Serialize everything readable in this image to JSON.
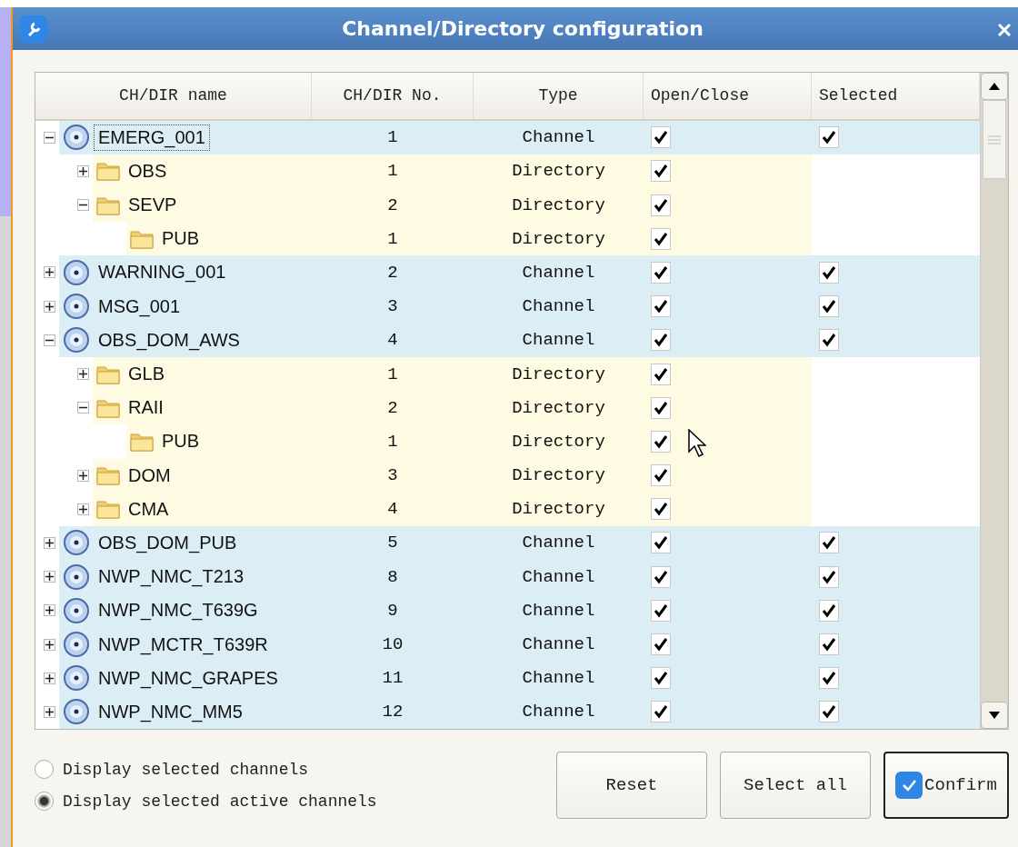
{
  "window": {
    "title": "Channel/Directory configuration"
  },
  "table": {
    "columns": [
      "CH/DIR name",
      "CH/DIR No.",
      "Type",
      "Open/Close",
      "Selected"
    ],
    "rows": [
      {
        "kind": "channel",
        "name": "EMERG_001",
        "number": "1",
        "type": "Channel",
        "open": true,
        "selected": true,
        "expanded": true,
        "focused": true,
        "children": [
          {
            "kind": "directory",
            "name": "OBS",
            "number": "1",
            "type": "Directory",
            "open": true,
            "expanded": false,
            "focused": false
          },
          {
            "kind": "directory",
            "name": "SEVP",
            "number": "2",
            "type": "Directory",
            "open": true,
            "expanded": true,
            "focused": false,
            "children": [
              {
                "kind": "directory",
                "name": "PUB",
                "number": "1",
                "type": "Directory",
                "open": true,
                "focused": false
              }
            ]
          }
        ]
      },
      {
        "kind": "channel",
        "name": "WARNING_001",
        "number": "2",
        "type": "Channel",
        "open": true,
        "selected": true,
        "expanded": false,
        "focused": false
      },
      {
        "kind": "channel",
        "name": "MSG_001",
        "number": "3",
        "type": "Channel",
        "open": true,
        "selected": true,
        "expanded": false,
        "focused": false
      },
      {
        "kind": "channel",
        "name": "OBS_DOM_AWS",
        "number": "4",
        "type": "Channel",
        "open": true,
        "selected": true,
        "expanded": true,
        "focused": false,
        "children": [
          {
            "kind": "directory",
            "name": "GLB",
            "number": "1",
            "type": "Directory",
            "open": true,
            "expanded": false,
            "focused": false
          },
          {
            "kind": "directory",
            "name": "RAII",
            "number": "2",
            "type": "Directory",
            "open": true,
            "expanded": true,
            "focused": false,
            "children": [
              {
                "kind": "directory",
                "name": "PUB",
                "number": "1",
                "type": "Directory",
                "open": true,
                "focused": false
              }
            ]
          },
          {
            "kind": "directory",
            "name": "DOM",
            "number": "3",
            "type": "Directory",
            "open": true,
            "expanded": false,
            "focused": false
          },
          {
            "kind": "directory",
            "name": "CMA",
            "number": "4",
            "type": "Directory",
            "open": true,
            "expanded": false,
            "focused": false
          }
        ]
      },
      {
        "kind": "channel",
        "name": "OBS_DOM_PUB",
        "number": "5",
        "type": "Channel",
        "open": true,
        "selected": true,
        "expanded": false,
        "focused": false
      },
      {
        "kind": "channel",
        "name": "NWP_NMC_T213",
        "number": "8",
        "type": "Channel",
        "open": true,
        "selected": true,
        "expanded": false,
        "focused": false
      },
      {
        "kind": "channel",
        "name": "NWP_NMC_T639G",
        "number": "9",
        "type": "Channel",
        "open": true,
        "selected": true,
        "expanded": false,
        "focused": false
      },
      {
        "kind": "channel",
        "name": "NWP_MCTR_T639R",
        "number": "10",
        "type": "Channel",
        "open": true,
        "selected": true,
        "expanded": false,
        "focused": false
      },
      {
        "kind": "channel",
        "name": "NWP_NMC_GRAPES",
        "number": "11",
        "type": "Channel",
        "open": true,
        "selected": true,
        "expanded": false,
        "focused": false
      },
      {
        "kind": "channel",
        "name": "NWP_NMC_MM5",
        "number": "12",
        "type": "Channel",
        "open": true,
        "selected": true,
        "expanded": false,
        "focused": false
      }
    ]
  },
  "display_options": [
    {
      "label": "Display selected channels",
      "selected": false
    },
    {
      "label": "Display selected active channels",
      "selected": true
    }
  ],
  "buttons": [
    {
      "label": "Reset",
      "default": false
    },
    {
      "label": "Select all",
      "default": false
    },
    {
      "label": "Confirm",
      "default": true
    }
  ]
}
